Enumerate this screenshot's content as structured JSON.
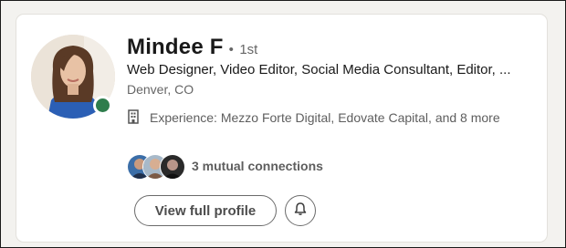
{
  "profile": {
    "name": "Mindee F",
    "separator": "•",
    "degree": "1st",
    "headline": "Web Designer, Video Editor, Social Media Consultant, Editor, ...",
    "location": "Denver, CO",
    "experience": "Experience: Mezzo Forte Digital, Edovate Capital, and 8 more",
    "presence_color": "#2e7d4c"
  },
  "mutual": {
    "text": "3 mutual connections"
  },
  "actions": {
    "view_profile_label": "View full profile",
    "bell_icon": "bell-icon"
  }
}
